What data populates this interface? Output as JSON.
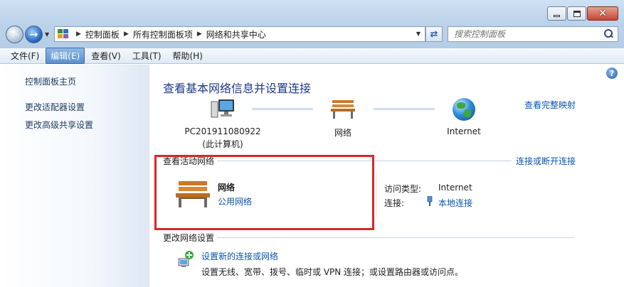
{
  "window": {
    "buttons": {
      "minimize": "minimize",
      "maximize": "maximize",
      "close": "✕"
    }
  },
  "address_bar": {
    "breadcrumbs": [
      "控制面板",
      "所有控制面板项",
      "网络和共享中心"
    ],
    "search_placeholder": "搜索控制面板"
  },
  "menu": {
    "items": [
      "文件(F)",
      "编辑(E)",
      "查看(V)",
      "工具(T)",
      "帮助(H)"
    ],
    "active_index": 1
  },
  "sidebar": {
    "links": [
      "控制面板主页",
      "更改适配器设置",
      "更改高级共享设置"
    ]
  },
  "main": {
    "title": "查看基本网络信息并设置连接",
    "full_map_link": "查看完整映射",
    "diagram": {
      "computer_name": "PC201911080922",
      "computer_sub": "(此计算机)",
      "network": "网络",
      "internet": "Internet"
    },
    "active_networks": {
      "section_title": "查看活动网络",
      "connect_link": "连接或断开连接",
      "network_name": "网络",
      "network_type": "公用网络",
      "access_type_label": "访问类型:",
      "access_type_value": "Internet",
      "connection_label": "连接:",
      "connection_value": "本地连接"
    },
    "change_settings": {
      "section_title": "更改网络设置",
      "setup_link": "设置新的连接或网络",
      "setup_desc": "设置无线、宽带、拨号、临时或 VPN 连接；或设置路由器或访问点。"
    },
    "highlight_color": "#d9262b",
    "link_color": "#0b55b0"
  }
}
